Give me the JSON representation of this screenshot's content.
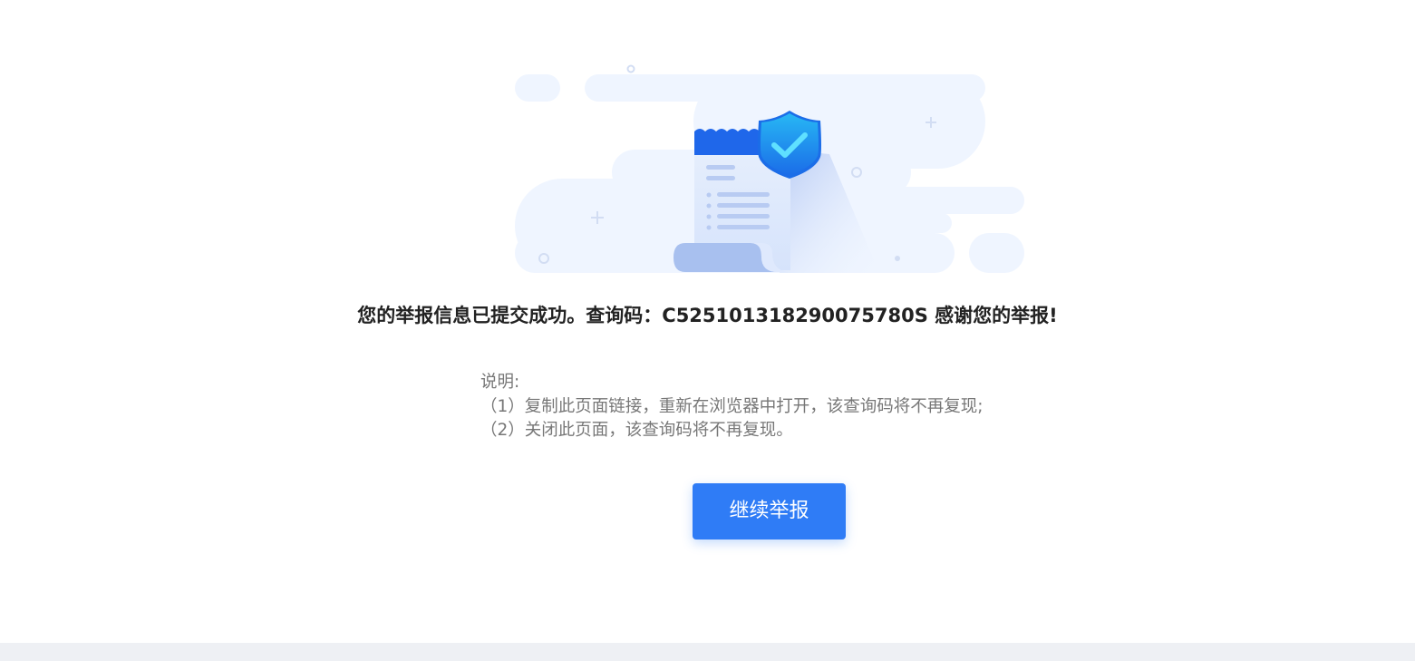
{
  "result": {
    "message": "您的举报信息已提交成功。查询码：C525101318290075780S 感谢您的举报!"
  },
  "notes": {
    "title": "说明:",
    "items": [
      "（1）复制此页面链接，重新在浏览器中打开，该查询码将不再复现;",
      "（2）关闭此页面，该查询码将不再复现。"
    ]
  },
  "actions": {
    "continue_label": "继续举报"
  },
  "icons": {
    "illustration": "document-shield-check-icon"
  },
  "colors": {
    "accent": "#2f7cf6",
    "cloud": "#eff5ff"
  }
}
